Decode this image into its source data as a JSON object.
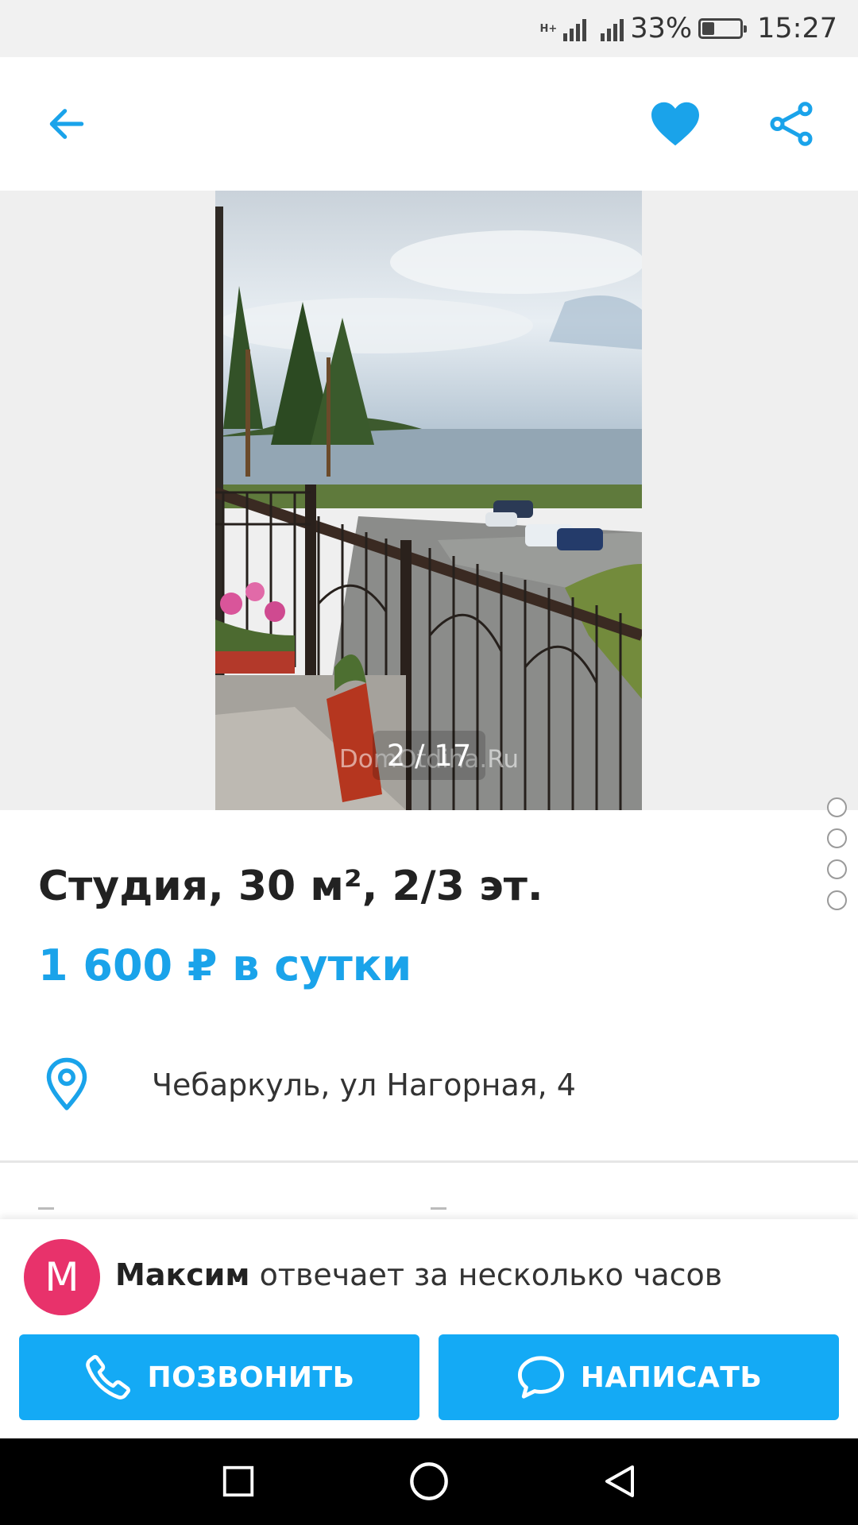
{
  "status_bar": {
    "network_label": "H+",
    "battery_percent": "33%",
    "battery_level": 0.33,
    "time": "15:27"
  },
  "app_bar": {
    "back_icon": "arrow-left-icon",
    "favorite_icon": "heart-icon",
    "share_icon": "share-icon",
    "accent_color": "#1aa3ea"
  },
  "gallery": {
    "counter": "2 / 17",
    "watermark": "DomOtdiha.Ru",
    "page_dots": 4
  },
  "listing": {
    "title": "Студия, 30 м², 2/3 эт.",
    "price": "1 600 ₽ в сутки",
    "price_color": "#1aa3ea",
    "address": "Чебаркуль, ул Нагорная, 4"
  },
  "contact": {
    "avatar_initial": "М",
    "avatar_color": "#e8326b",
    "seller_name": "Максим",
    "seller_status": "отвечает за несколько часов",
    "call_label": "ПОЗВОНИТЬ",
    "write_label": "НАПИСАТЬ",
    "button_color": "#14aaf5"
  },
  "nav_bar": {
    "recent_icon": "square-icon",
    "home_icon": "circle-icon",
    "back_icon": "triangle-back-icon"
  }
}
